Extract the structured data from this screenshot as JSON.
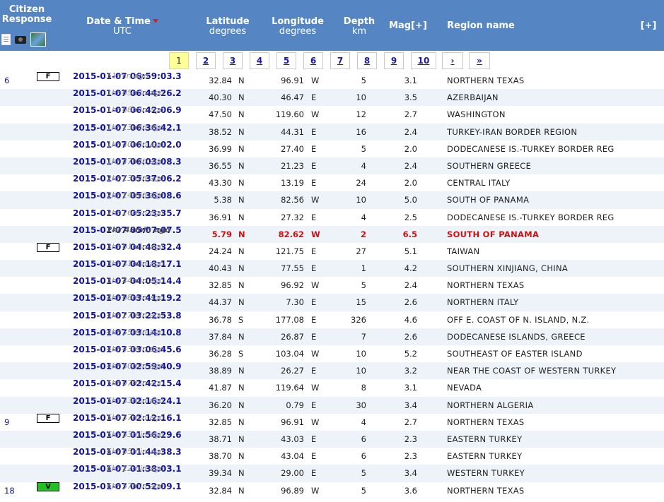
{
  "header": {
    "citizen_line1": "Citizen",
    "citizen_line2": "Response",
    "date_title": "Date & Time",
    "date_sub": "UTC",
    "lat_title": "Latitude",
    "lat_sub": "degrees",
    "lon_title": "Longitude",
    "lon_sub": "degrees",
    "depth_title": "Depth",
    "depth_sub": "km",
    "mag_title": "Mag[+]",
    "region_title": "Region name",
    "expand": "[+]"
  },
  "pager": [
    "1",
    "2",
    "3",
    "4",
    "5",
    "6",
    "7",
    "8",
    "9",
    "10",
    "›",
    "»"
  ],
  "rows": [
    {
      "num": "6",
      "badge": "F",
      "dt": "2015-01-07   06:59:03.3",
      "ago": "51min ago",
      "lat": "32.84",
      "ns": "N",
      "lon": "96.91",
      "ew": "W",
      "depth": "5",
      "mag": "3.1",
      "region": "NORTHERN TEXAS"
    },
    {
      "num": "",
      "badge": "",
      "dt": "2015-01-07   06:44:26.2",
      "ago": "1hr 05min ago",
      "lat": "40.30",
      "ns": "N",
      "lon": "46.47",
      "ew": "E",
      "depth": "10",
      "mag": "3.5",
      "region": "AZERBAIJAN"
    },
    {
      "num": "",
      "badge": "",
      "dt": "2015-01-07   06:42:06.9",
      "ago": "1hr 08min ago",
      "lat": "47.50",
      "ns": "N",
      "lon": "119.60",
      "ew": "W",
      "depth": "12",
      "mag": "2.7",
      "region": "WASHINGTON"
    },
    {
      "num": "",
      "badge": "",
      "dt": "2015-01-07   06:36:42.1",
      "ago": "1hr 13min ago",
      "lat": "38.52",
      "ns": "N",
      "lon": "44.31",
      "ew": "E",
      "depth": "16",
      "mag": "2.4",
      "region": "TURKEY-IRAN BORDER REGION"
    },
    {
      "num": "",
      "badge": "",
      "dt": "2015-01-07   06:10:02.0",
      "ago": "1hr 40min ago",
      "lat": "36.99",
      "ns": "N",
      "lon": "27.40",
      "ew": "E",
      "depth": "5",
      "mag": "2.0",
      "region": "DODECANESE IS.-TURKEY BORDER REG"
    },
    {
      "num": "",
      "badge": "",
      "dt": "2015-01-07   06:03:08.3",
      "ago": "1hr 47min ago",
      "lat": "36.55",
      "ns": "N",
      "lon": "21.23",
      "ew": "E",
      "depth": "4",
      "mag": "2.4",
      "region": "SOUTHERN GREECE"
    },
    {
      "num": "",
      "badge": "",
      "dt": "2015-01-07   05:37:06.2",
      "ago": "2hr 13min ago",
      "lat": "43.30",
      "ns": "N",
      "lon": "13.19",
      "ew": "E",
      "depth": "24",
      "mag": "2.0",
      "region": "CENTRAL ITALY"
    },
    {
      "num": "",
      "badge": "",
      "dt": "2015-01-07   05:36:08.6",
      "ago": "2hr 14min ago",
      "lat": "5.38",
      "ns": "N",
      "lon": "82.56",
      "ew": "W",
      "depth": "10",
      "mag": "5.0",
      "region": "SOUTH OF PANAMA"
    },
    {
      "num": "",
      "badge": "",
      "dt": "2015-01-07   05:23:35.7",
      "ago": "2hr 26min ago",
      "lat": "36.91",
      "ns": "N",
      "lon": "27.32",
      "ew": "E",
      "depth": "4",
      "mag": "2.5",
      "region": "DODECANESE IS.-TURKEY BORDER REG"
    },
    {
      "num": "",
      "badge": "",
      "dt": "2015-01-07   05:07:07.5",
      "ago": "2hr 43min ago",
      "lat": "5.79",
      "ns": "N",
      "lon": "82.62",
      "ew": "W",
      "depth": "2",
      "mag": "6.5",
      "region": "SOUTH OF PANAMA",
      "highlight": true
    },
    {
      "num": "",
      "badge": "F",
      "dt": "2015-01-07   04:48:32.4",
      "ago": "3hr 01min ago",
      "lat": "24.24",
      "ns": "N",
      "lon": "121.75",
      "ew": "E",
      "depth": "27",
      "mag": "5.1",
      "region": "TAIWAN"
    },
    {
      "num": "",
      "badge": "",
      "dt": "2015-01-07   04:18:17.1",
      "ago": "3hr 31min ago",
      "lat": "40.43",
      "ns": "N",
      "lon": "77.55",
      "ew": "E",
      "depth": "1",
      "mag": "4.2",
      "region": "SOUTHERN XINJIANG, CHINA"
    },
    {
      "num": "",
      "badge": "",
      "dt": "2015-01-07   04:05:14.4",
      "ago": "3hr 44min ago",
      "lat": "32.85",
      "ns": "N",
      "lon": "96.92",
      "ew": "W",
      "depth": "5",
      "mag": "2.4",
      "region": "NORTHERN TEXAS"
    },
    {
      "num": "",
      "badge": "",
      "dt": "2015-01-07   03:41:19.2",
      "ago": "4hr 08min ago",
      "lat": "44.37",
      "ns": "N",
      "lon": "7.30",
      "ew": "E",
      "depth": "15",
      "mag": "2.6",
      "region": "NORTHERN ITALY"
    },
    {
      "num": "",
      "badge": "",
      "dt": "2015-01-07   03:22:53.8",
      "ago": "4hr 27min ago",
      "lat": "36.78",
      "ns": "S",
      "lon": "177.08",
      "ew": "E",
      "depth": "326",
      "mag": "4.6",
      "region": "OFF E. COAST OF N. ISLAND, N.Z."
    },
    {
      "num": "",
      "badge": "",
      "dt": "2015-01-07   03:14:10.8",
      "ago": "4hr 35min ago",
      "lat": "37.84",
      "ns": "N",
      "lon": "26.87",
      "ew": "E",
      "depth": "7",
      "mag": "2.6",
      "region": "DODECANESE ISLANDS, GREECE"
    },
    {
      "num": "",
      "badge": "",
      "dt": "2015-01-07   03:06:45.6",
      "ago": "4hr 43min ago",
      "lat": "36.28",
      "ns": "S",
      "lon": "103.04",
      "ew": "W",
      "depth": "10",
      "mag": "5.2",
      "region": "SOUTHEAST OF EASTER ISLAND"
    },
    {
      "num": "",
      "badge": "",
      "dt": "2015-01-07   02:59:40.9",
      "ago": "4hr 50min ago",
      "lat": "38.89",
      "ns": "N",
      "lon": "26.27",
      "ew": "E",
      "depth": "10",
      "mag": "3.2",
      "region": "NEAR THE COAST OF WESTERN TURKEY"
    },
    {
      "num": "",
      "badge": "",
      "dt": "2015-01-07   02:42:15.4",
      "ago": "5hr 07min ago",
      "lat": "41.87",
      "ns": "N",
      "lon": "119.64",
      "ew": "W",
      "depth": "8",
      "mag": "3.1",
      "region": "NEVADA"
    },
    {
      "num": "",
      "badge": "",
      "dt": "2015-01-07   02:16:24.1",
      "ago": "5hr 33min ago",
      "lat": "36.20",
      "ns": "N",
      "lon": "0.79",
      "ew": "E",
      "depth": "30",
      "mag": "3.4",
      "region": "NORTHERN ALGERIA"
    },
    {
      "num": "9",
      "badge": "F",
      "dt": "2015-01-07   02:12:16.1",
      "ago": "5hr 37min ago",
      "lat": "32.85",
      "ns": "N",
      "lon": "96.91",
      "ew": "W",
      "depth": "4",
      "mag": "2.7",
      "region": "NORTHERN TEXAS"
    },
    {
      "num": "",
      "badge": "",
      "dt": "2015-01-07   01:56:29.6",
      "ago": "5hr 53min ago",
      "lat": "38.71",
      "ns": "N",
      "lon": "43.03",
      "ew": "E",
      "depth": "6",
      "mag": "2.3",
      "region": "EASTERN TURKEY"
    },
    {
      "num": "",
      "badge": "",
      "dt": "2015-01-07   01:44:38.3",
      "ago": "6hr 05min ago",
      "lat": "38.70",
      "ns": "N",
      "lon": "43.04",
      "ew": "E",
      "depth": "6",
      "mag": "2.3",
      "region": "EASTERN TURKEY"
    },
    {
      "num": "",
      "badge": "",
      "dt": "2015-01-07   01:38:03.1",
      "ago": "6hr 12min ago",
      "lat": "39.34",
      "ns": "N",
      "lon": "29.00",
      "ew": "E",
      "depth": "5",
      "mag": "3.4",
      "region": "WESTERN TURKEY"
    },
    {
      "num": "18",
      "badge": "V",
      "dt": "2015-01-07   00:52:09.1",
      "ago": "6hr 57min ago",
      "lat": "32.84",
      "ns": "N",
      "lon": "96.89",
      "ew": "W",
      "depth": "5",
      "mag": "3.6",
      "region": "NORTHERN TEXAS"
    }
  ]
}
